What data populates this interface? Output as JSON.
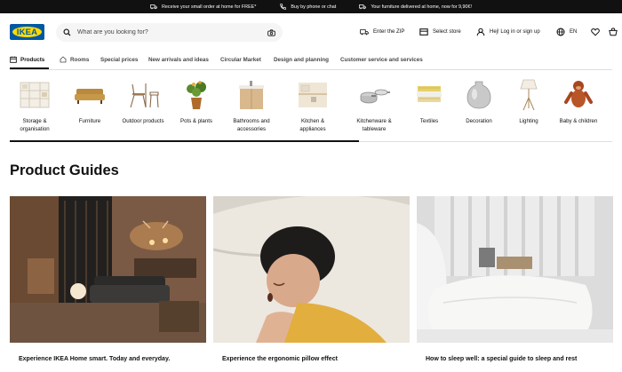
{
  "promo": {
    "items": [
      {
        "icon": "delivery-truck-icon",
        "text": "Receive your small order at home for FREE*"
      },
      {
        "icon": "phone-icon",
        "text": "Buy by phone or chat"
      },
      {
        "icon": "delivery-truck-icon",
        "text": "Your furniture delivered at home, now for 9,90€!"
      }
    ]
  },
  "header": {
    "logo": "IKEA",
    "search_placeholder": "What are you looking for?",
    "zip_label": "Enter the ZIP",
    "store_label": "Select store",
    "login_label": "Hej! Log in or sign up",
    "language": "EN"
  },
  "nav": {
    "tabs": [
      "Products",
      "Rooms",
      "Special prices",
      "New arrivals and ideas",
      "Circular Market",
      "Design and planning",
      "Customer service and services"
    ]
  },
  "categories": [
    [
      "Storage &",
      "organisation"
    ],
    [
      "Furniture",
      ""
    ],
    [
      "Outdoor products",
      ""
    ],
    [
      "Pots & plants",
      ""
    ],
    [
      "Bathrooms and",
      "accessories"
    ],
    [
      "Kitchen &",
      "appliances"
    ],
    [
      "Kitchenware &",
      "tableware"
    ],
    [
      "Textiles",
      ""
    ],
    [
      "Decoration",
      ""
    ],
    [
      "Lighting",
      ""
    ],
    [
      "Baby & children",
      ""
    ]
  ],
  "guides": {
    "title": "Product Guides",
    "cards": [
      "Experience IKEA Home smart. Today and everyday.",
      "Experience the ergonomic pillow effect",
      "How to sleep well: a special guide to sleep and rest"
    ]
  },
  "colors": {
    "brand_blue": "#0058a3",
    "brand_yellow": "#ffdb00",
    "promo_bg": "#111111"
  }
}
